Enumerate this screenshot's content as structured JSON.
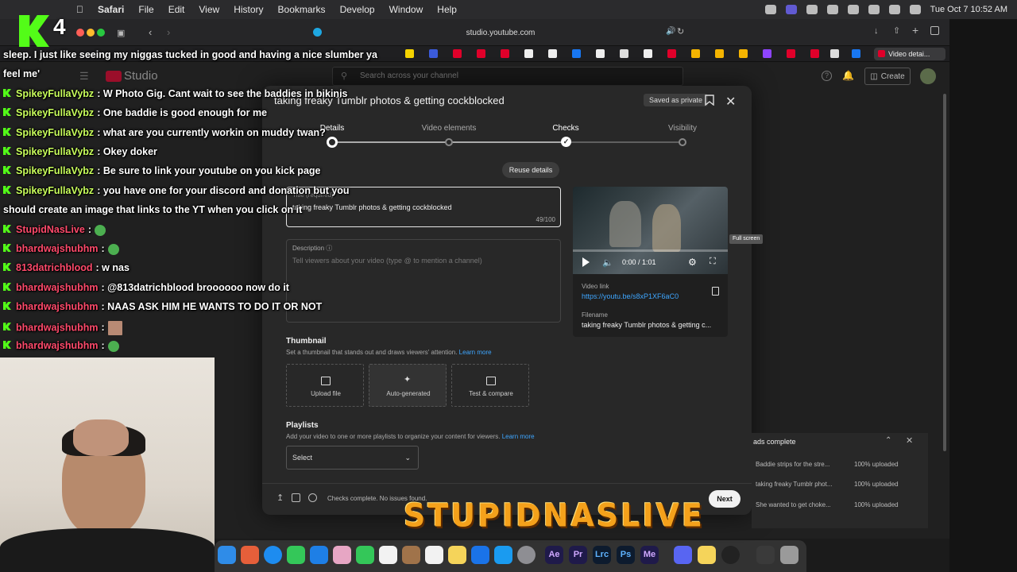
{
  "menubar": {
    "app": "Safari",
    "items": [
      "File",
      "Edit",
      "View",
      "History",
      "Bookmarks",
      "Develop",
      "Window",
      "Help"
    ],
    "clock": "Tue Oct 7  10:52 AM"
  },
  "browser": {
    "url": "studio.youtube.com",
    "active_tab": "Video detai..."
  },
  "studio": {
    "logo_text": "Studio",
    "search_placeholder": "Search across your channel",
    "create_label": "Create"
  },
  "modal": {
    "title": "taking freaky Tumblr photos & getting cockblocked",
    "saved_badge": "Saved as private",
    "steps": [
      {
        "label": "Details",
        "state": "current"
      },
      {
        "label": "Video elements",
        "state": "pending"
      },
      {
        "label": "Checks",
        "state": "done"
      },
      {
        "label": "Visibility",
        "state": "pending"
      }
    ],
    "reuse_label": "Reuse details",
    "title_field": {
      "label": "Title (required)",
      "value": "taking freaky Tumblr photos & getting cockblocked",
      "count": "49/100"
    },
    "description": {
      "label": "Description",
      "placeholder": "Tell viewers about your video (type @ to mention a channel)"
    },
    "video": {
      "time": "0:00 / 1:01",
      "progress": 0.0,
      "link_label": "Video link",
      "link": "https://youtu.be/s8xP1XF6aC0",
      "filename_label": "Filename",
      "filename": "taking freaky Tumblr photos & getting c...",
      "fullscreen_tip": "Full screen"
    },
    "thumbnail": {
      "heading": "Thumbnail",
      "sub": "Set a thumbnail that stands out and draws viewers' attention.",
      "learn_more": "Learn more",
      "options": [
        "Upload file",
        "Auto-generated",
        "Test & compare"
      ]
    },
    "playlists": {
      "heading": "Playlists",
      "sub": "Add your video to one or more playlists to organize your content for viewers.",
      "learn_more": "Learn more",
      "select_value": "Select"
    },
    "footer": {
      "status": "Checks complete. No issues found.",
      "next_label": "Next"
    }
  },
  "uploads": {
    "title": "ads complete",
    "rows": [
      {
        "name": "Baddie strips for the stre...",
        "status": "100% uploaded"
      },
      {
        "name": "taking freaky Tumblr phot...",
        "status": "100% uploaded"
      },
      {
        "name": "She wanted to get choke...",
        "status": "100% uploaded"
      }
    ]
  },
  "stream": {
    "viewer_count": "4",
    "brand": "STUPIDNASLIVE",
    "chat": [
      {
        "user": "",
        "text": "sleep. I just like seeing my niggas tucked in good and having a nice slumber ya",
        "user_color": "#ffffff"
      },
      {
        "user": "",
        "text": "feel me'",
        "user_color": "#ffffff"
      },
      {
        "user": "SpikeyFullaVybz",
        "text": ": W Photo Gig. Cant wait to see the baddies in bikinis",
        "user_color": "#c9ff5c"
      },
      {
        "user": "SpikeyFullaVybz",
        "text": ": One baddie is good enough for me",
        "user_color": "#c9ff5c"
      },
      {
        "user": "SpikeyFullaVybz",
        "text": ": what are you currently workin on muddy twan?",
        "user_color": "#c9ff5c"
      },
      {
        "user": "SpikeyFullaVybz",
        "text": ": Okey doker",
        "user_color": "#c9ff5c"
      },
      {
        "user": "SpikeyFullaVybz",
        "text": ": Be sure to link your youtube on you kick page",
        "user_color": "#c9ff5c"
      },
      {
        "user": "SpikeyFullaVybz",
        "text": ": you have one for your discord and donation but you",
        "user_color": "#c9ff5c"
      },
      {
        "user": "",
        "text": "should create an image that links to the YT when you click on it",
        "user_color": "#ffffff"
      },
      {
        "user": "StupidNasLive",
        "text": ":",
        "user_color": "#ff4a6b",
        "emote": "green"
      },
      {
        "user": "bhardwajshubhm",
        "text": ":",
        "user_color": "#ff4a6b",
        "emote": "green"
      },
      {
        "user": "813datrichblood",
        "text": ": w nas",
        "user_color": "#ff4a6b"
      },
      {
        "user": "bhardwajshubhm",
        "text": ": @813datrichblood broooooo now do it",
        "user_color": "#ff4a6b"
      },
      {
        "user": "bhardwajshubhm",
        "text": ": NAAS ASK HIM HE WANTS TO DO IT OR NOT",
        "user_color": "#ff4a6b"
      },
      {
        "user": "bhardwajshubhm",
        "text": ":",
        "user_color": "#ff4a6b",
        "emote": "photo"
      },
      {
        "user": "bhardwajshubhm",
        "text": ":",
        "user_color": "#ff4a6b",
        "emote": "green"
      }
    ]
  },
  "dock": {
    "labels": [
      "Ae",
      "Pr",
      "Lrc",
      "Ps",
      "Me"
    ]
  },
  "colors": {
    "kick_green": "#53fc18",
    "link_blue": "#3ea6ff",
    "brand_orange": "#f4a11b"
  }
}
